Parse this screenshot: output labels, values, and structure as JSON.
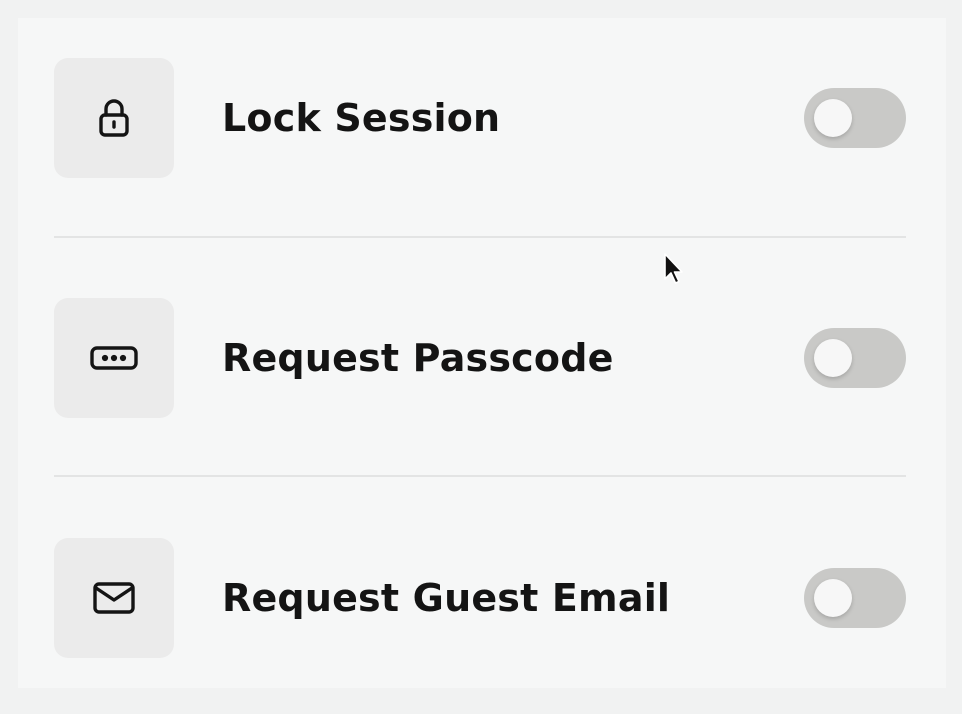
{
  "settings": {
    "items": [
      {
        "label": "Lock Session",
        "icon": "lock-icon",
        "enabled": false
      },
      {
        "label": "Request Passcode",
        "icon": "passcode-icon",
        "enabled": false
      },
      {
        "label": "Request Guest Email",
        "icon": "mail-icon",
        "enabled": false
      }
    ]
  },
  "colors": {
    "tile": "#ebebeb",
    "toggle_off": "#c9c9c7",
    "text": "#141414",
    "background": "#f6f7f7"
  }
}
